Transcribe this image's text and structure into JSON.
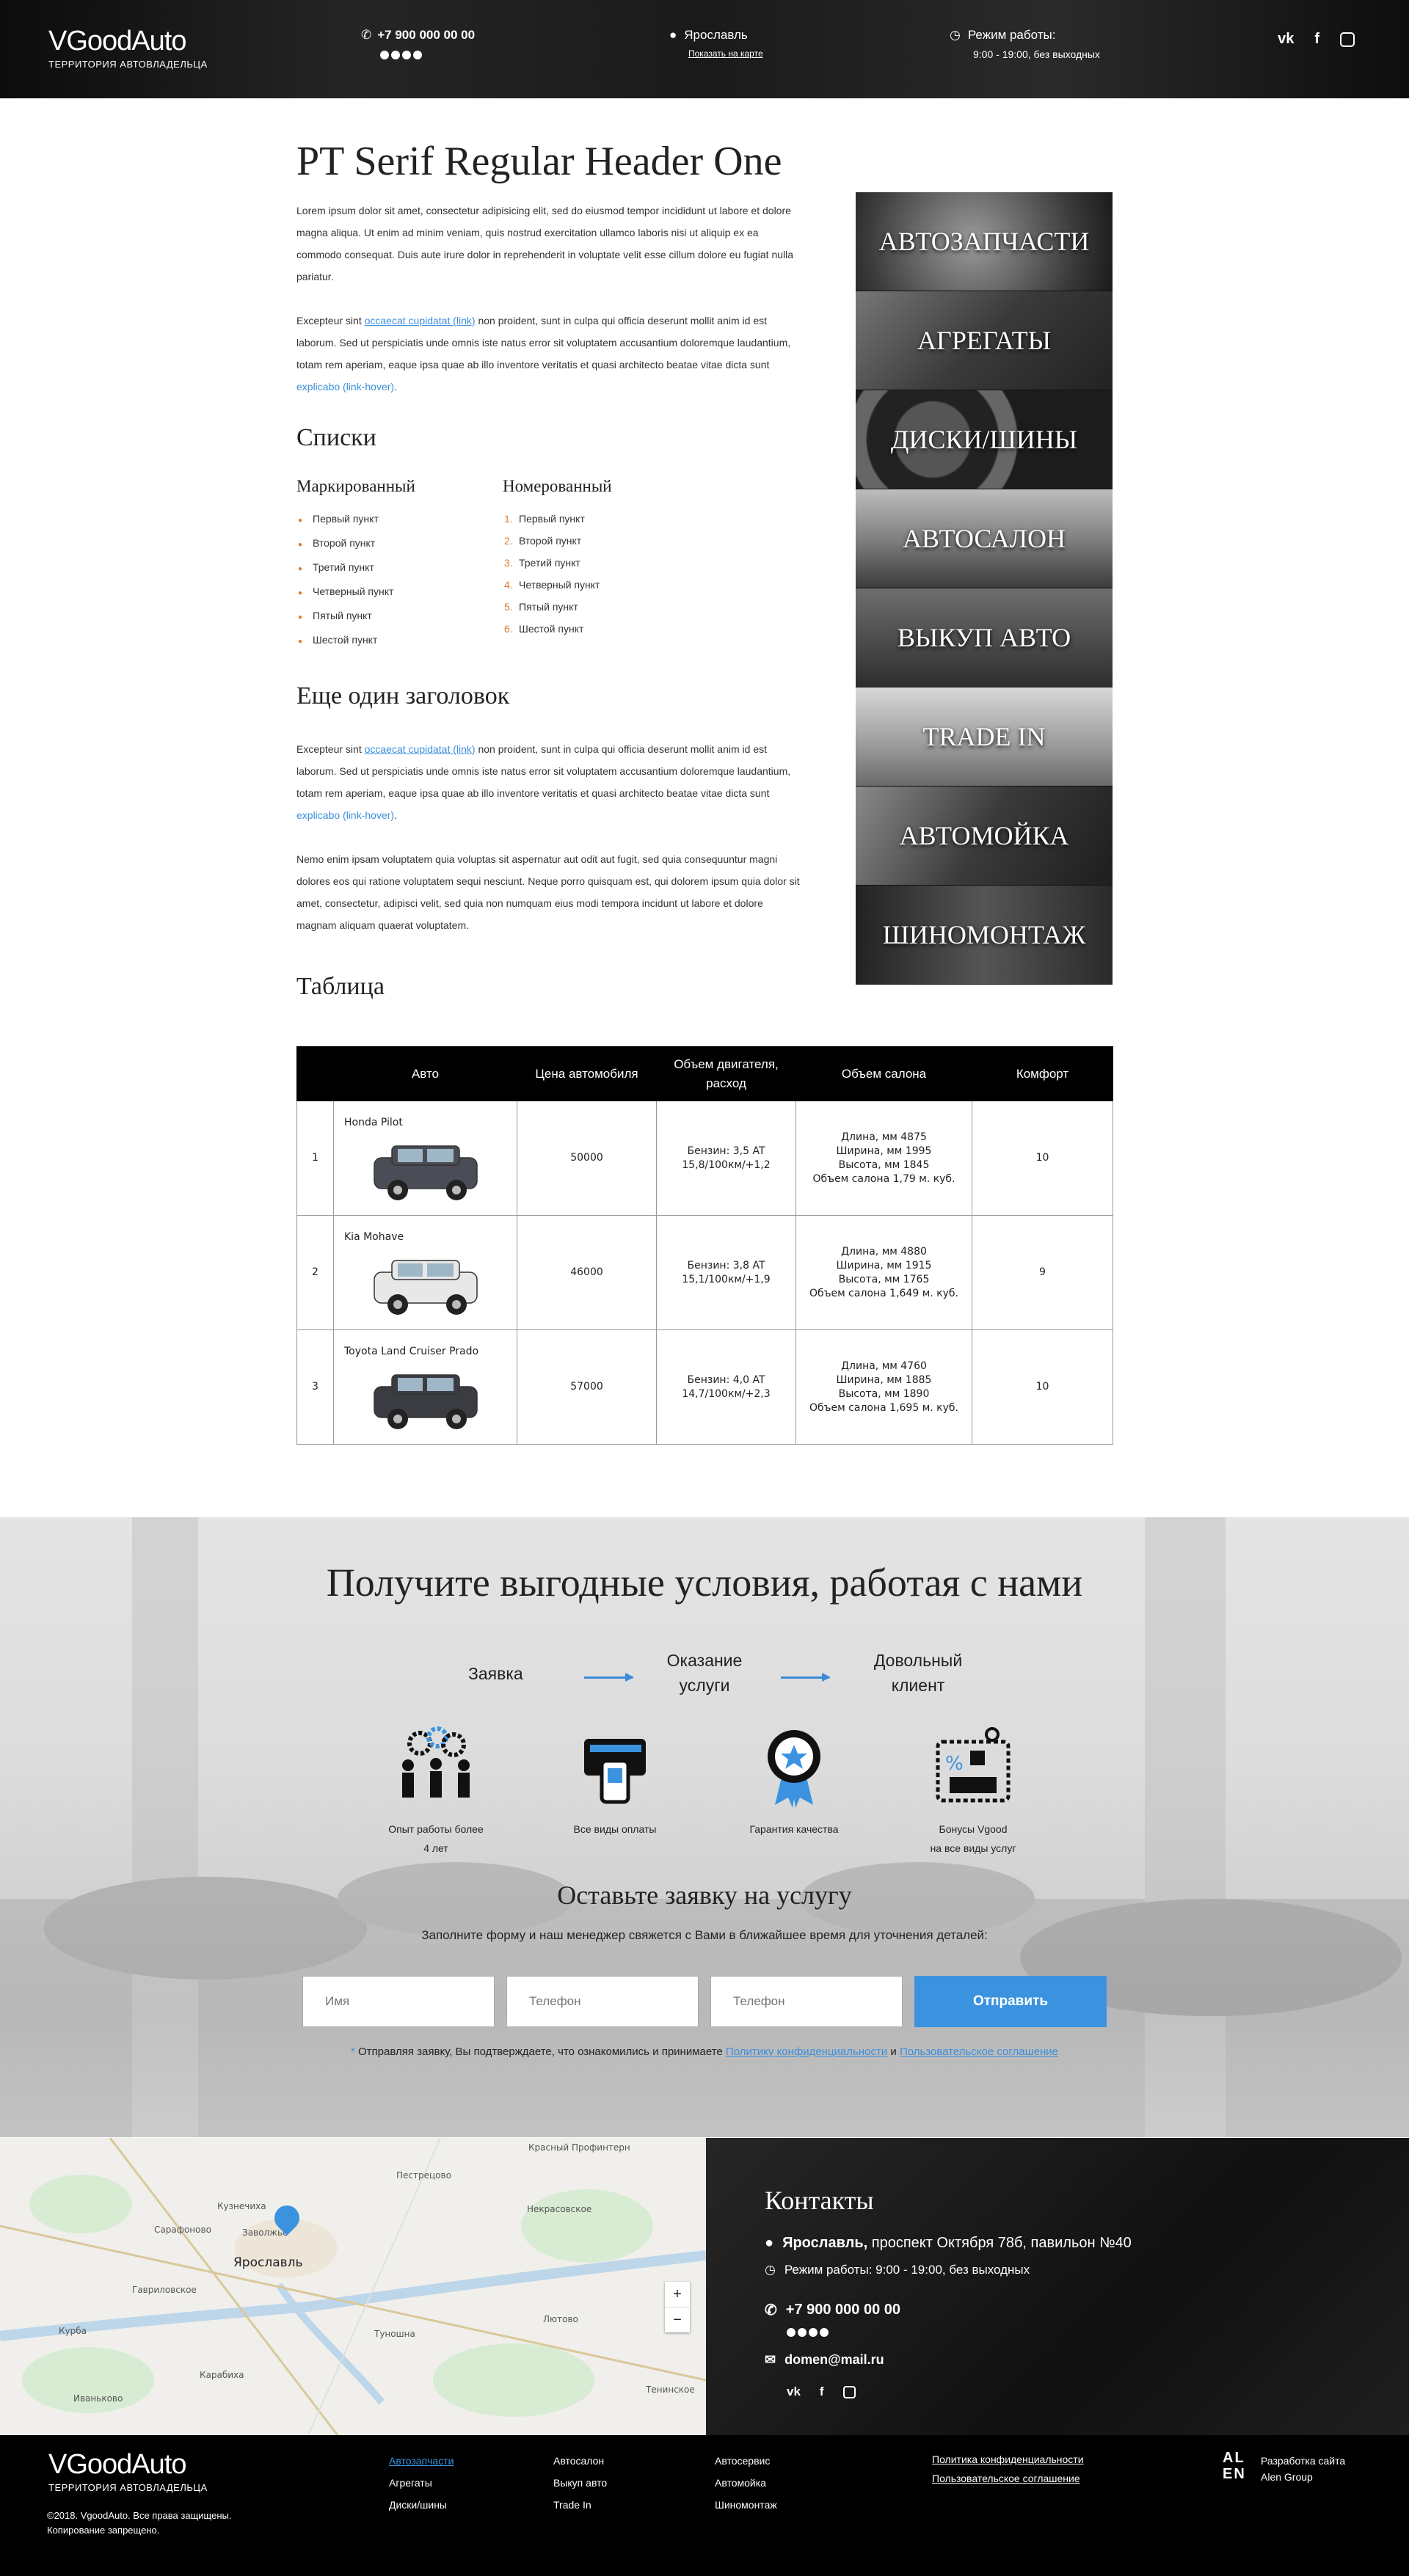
{
  "header": {
    "logo_text": "VGoodAuto",
    "logo_sub": "ТЕРРИТОРИЯ АВТОВЛАДЕЛЬЦА",
    "phone": "+7 900 000 00 00",
    "city": "Ярославль",
    "map_link": "Показать на карте",
    "hours_label": "Режим работы:",
    "hours": "9:00 - 19:00, без выходных",
    "social_icons": [
      "vk-icon",
      "facebook-icon",
      "instagram-icon"
    ]
  },
  "content": {
    "h1": "PT Serif Regular Header One",
    "p1": "Lorem ipsum dolor sit amet, consectetur adipisicing elit, sed do eiusmod tempor incididunt ut labore et dolore magna aliqua. Ut enim ad minim veniam, quis nostrud exercitation ullamco laboris nisi ut aliquip ex ea commodo consequat. Duis aute irure dolor in reprehenderit in voluptate velit esse cillum dolore eu fugiat nulla pariatur.",
    "p2_a": "Excepteur sint ",
    "p2_link": "occaecat cupidatat (link)",
    "p2_b": " non proident, sunt in culpa qui officia deserunt mollit anim id est laborum. Sed ut perspiciatis unde omnis iste natus error sit voluptatem accusantium doloremque laudantium, totam rem aperiam, eaque ipsa quae ab illo inventore veritatis et quasi architecto beatae vitae dicta sunt ",
    "p2_hover": "explicabo (link-hover)",
    "p2_end": ".",
    "lists_title": "Списки",
    "ul_title": "Маркированный",
    "ol_title": "Номерованный",
    "items": [
      "Первый пункт",
      "Второй пункт",
      "Третий пункт",
      "Четверный пункт",
      "Пятый пункт",
      "Шестой пункт"
    ],
    "h2b": "Еще один заголовок",
    "p4": "Nemo enim ipsam voluptatem quia voluptas sit aspernatur aut odit aut fugit, sed quia consequuntur magni dolores eos qui ratione voluptatem sequi nesciunt. Neque porro quisquam est, qui dolorem ipsum quia dolor sit amet, consectetur, adipisci velit, sed quia non numquam eius modi tempora incidunt ut labore et dolore magnam aliquam quaerat voluptatem.",
    "table_title": "Таблица"
  },
  "categories": [
    "АВТОЗАПЧАСТИ",
    "АГРЕГАТЫ",
    "ДИСКИ/ШИНЫ",
    "АВТОСАЛОН",
    "ВЫКУП АВТО",
    "TRADE IN",
    "АВТОМОЙКА",
    "ШИНОМОНТАЖ"
  ],
  "table": {
    "headers": [
      "",
      "Авто",
      "Цена автомобиля",
      "Объем двигателя, расход",
      "Объем салона",
      "Комфорт"
    ],
    "rows": [
      {
        "n": "1",
        "name": "Honda Pilot",
        "price": "50000",
        "engine1": "Бензин: 3,5 AT",
        "engine2": "15,8/100км/+1,2",
        "s1": "Длина, мм 4875",
        "s2": "Ширина, мм 1995",
        "s3": "Высота, мм 1845",
        "s4": "Объем салона 1,79 м. куб.",
        "comfort": "10",
        "color": "#4a4d55"
      },
      {
        "n": "2",
        "name": "Kia Mohave",
        "price": "46000",
        "engine1": "Бензин: 3,8 AT",
        "engine2": "15,1/100км/+1,9",
        "s1": "Длина, мм 4880",
        "s2": "Ширина, мм 1915",
        "s3": "Высота, мм 1765",
        "s4": "Объем салона 1,649 м. куб.",
        "comfort": "9",
        "color": "#e8e8e8"
      },
      {
        "n": "3",
        "name": "Toyota Land Cruiser Prado",
        "price": "57000",
        "engine1": "Бензин: 4,0 AT",
        "engine2": "14,7/100км/+2,3",
        "s1": "Длина, мм 4760",
        "s2": "Ширина, мм 1885",
        "s3": "Высота, мм 1890",
        "s4": "Объем салона 1,695 м. куб.",
        "comfort": "10",
        "color": "#3a3c42"
      }
    ]
  },
  "cta": {
    "title": "Получите выгодные условия, работая с нами",
    "step1": "Заявка",
    "step2a": "Оказание",
    "step2b": "услуги",
    "step3a": "Довольный",
    "step3b": "клиент",
    "f1a": "Опыт работы более",
    "f1b": "4 лет",
    "f2": "Все виды оплаты",
    "f3": "Гарантия качества",
    "f4a": "Бонусы Vgood",
    "f4b": "на все виды услуг",
    "form_title": "Оставьте заявку на услугу",
    "form_sub": "Заполните форму и наш менеджер свяжется с Вами в ближайшее время для уточнения деталей:",
    "name_ph": "Имя",
    "phone_ph": "Телефон",
    "phone2_ph": "Телефон",
    "submit": "Отправить",
    "consent_a": "Отправляя заявку, Вы подтверждаете, что ознакомились и принимаете ",
    "consent_link1": "Политику конфиденциальности",
    "consent_and": " и ",
    "consent_link2": "Пользовательское соглашение",
    "accent": "#3b93e0"
  },
  "map": {
    "labels": [
      "Ярославль",
      "Кузнечиха",
      "Некрасовское",
      "Пестрецово",
      "Сарафоново",
      "Заволжье",
      "Туношна",
      "Карабиха",
      "Иваньково",
      "Курба",
      "Лютово",
      "Красный Профинтерн",
      "Гавриловское",
      "Тенинское"
    ],
    "zoom_in": "+",
    "zoom_out": "−"
  },
  "contacts": {
    "title": "Контакты",
    "city": "Ярославль,",
    "address": " проспект Октября 78б, павильон №40",
    "hours": "Режим работы: 9:00 - 19:00, без выходных",
    "phone": "+7 900 000 00 00",
    "email": "domen@mail.ru"
  },
  "footer": {
    "logo_text": "VGoodAuto",
    "logo_sub": "ТЕРРИТОРИЯ АВТОВЛАДЕЛЬЦА",
    "copy1": "©2018. VgoodAuto. Все права защищены.",
    "copy2": "Копирование запрещено.",
    "col1": [
      "Автозапчасти",
      "Агрегаты",
      "Диски/шины"
    ],
    "col2": [
      "Автосалон",
      "Выкуп авто",
      "Trade In"
    ],
    "col3": [
      "Автосервис",
      "Автомойка",
      "Шиномонтаж"
    ],
    "legal": [
      "Политика конфиденциальности",
      "Пользовательское соглашение"
    ],
    "dev1": "Разработка сайта",
    "dev2": "Alen Group",
    "alen": "AL EN"
  }
}
